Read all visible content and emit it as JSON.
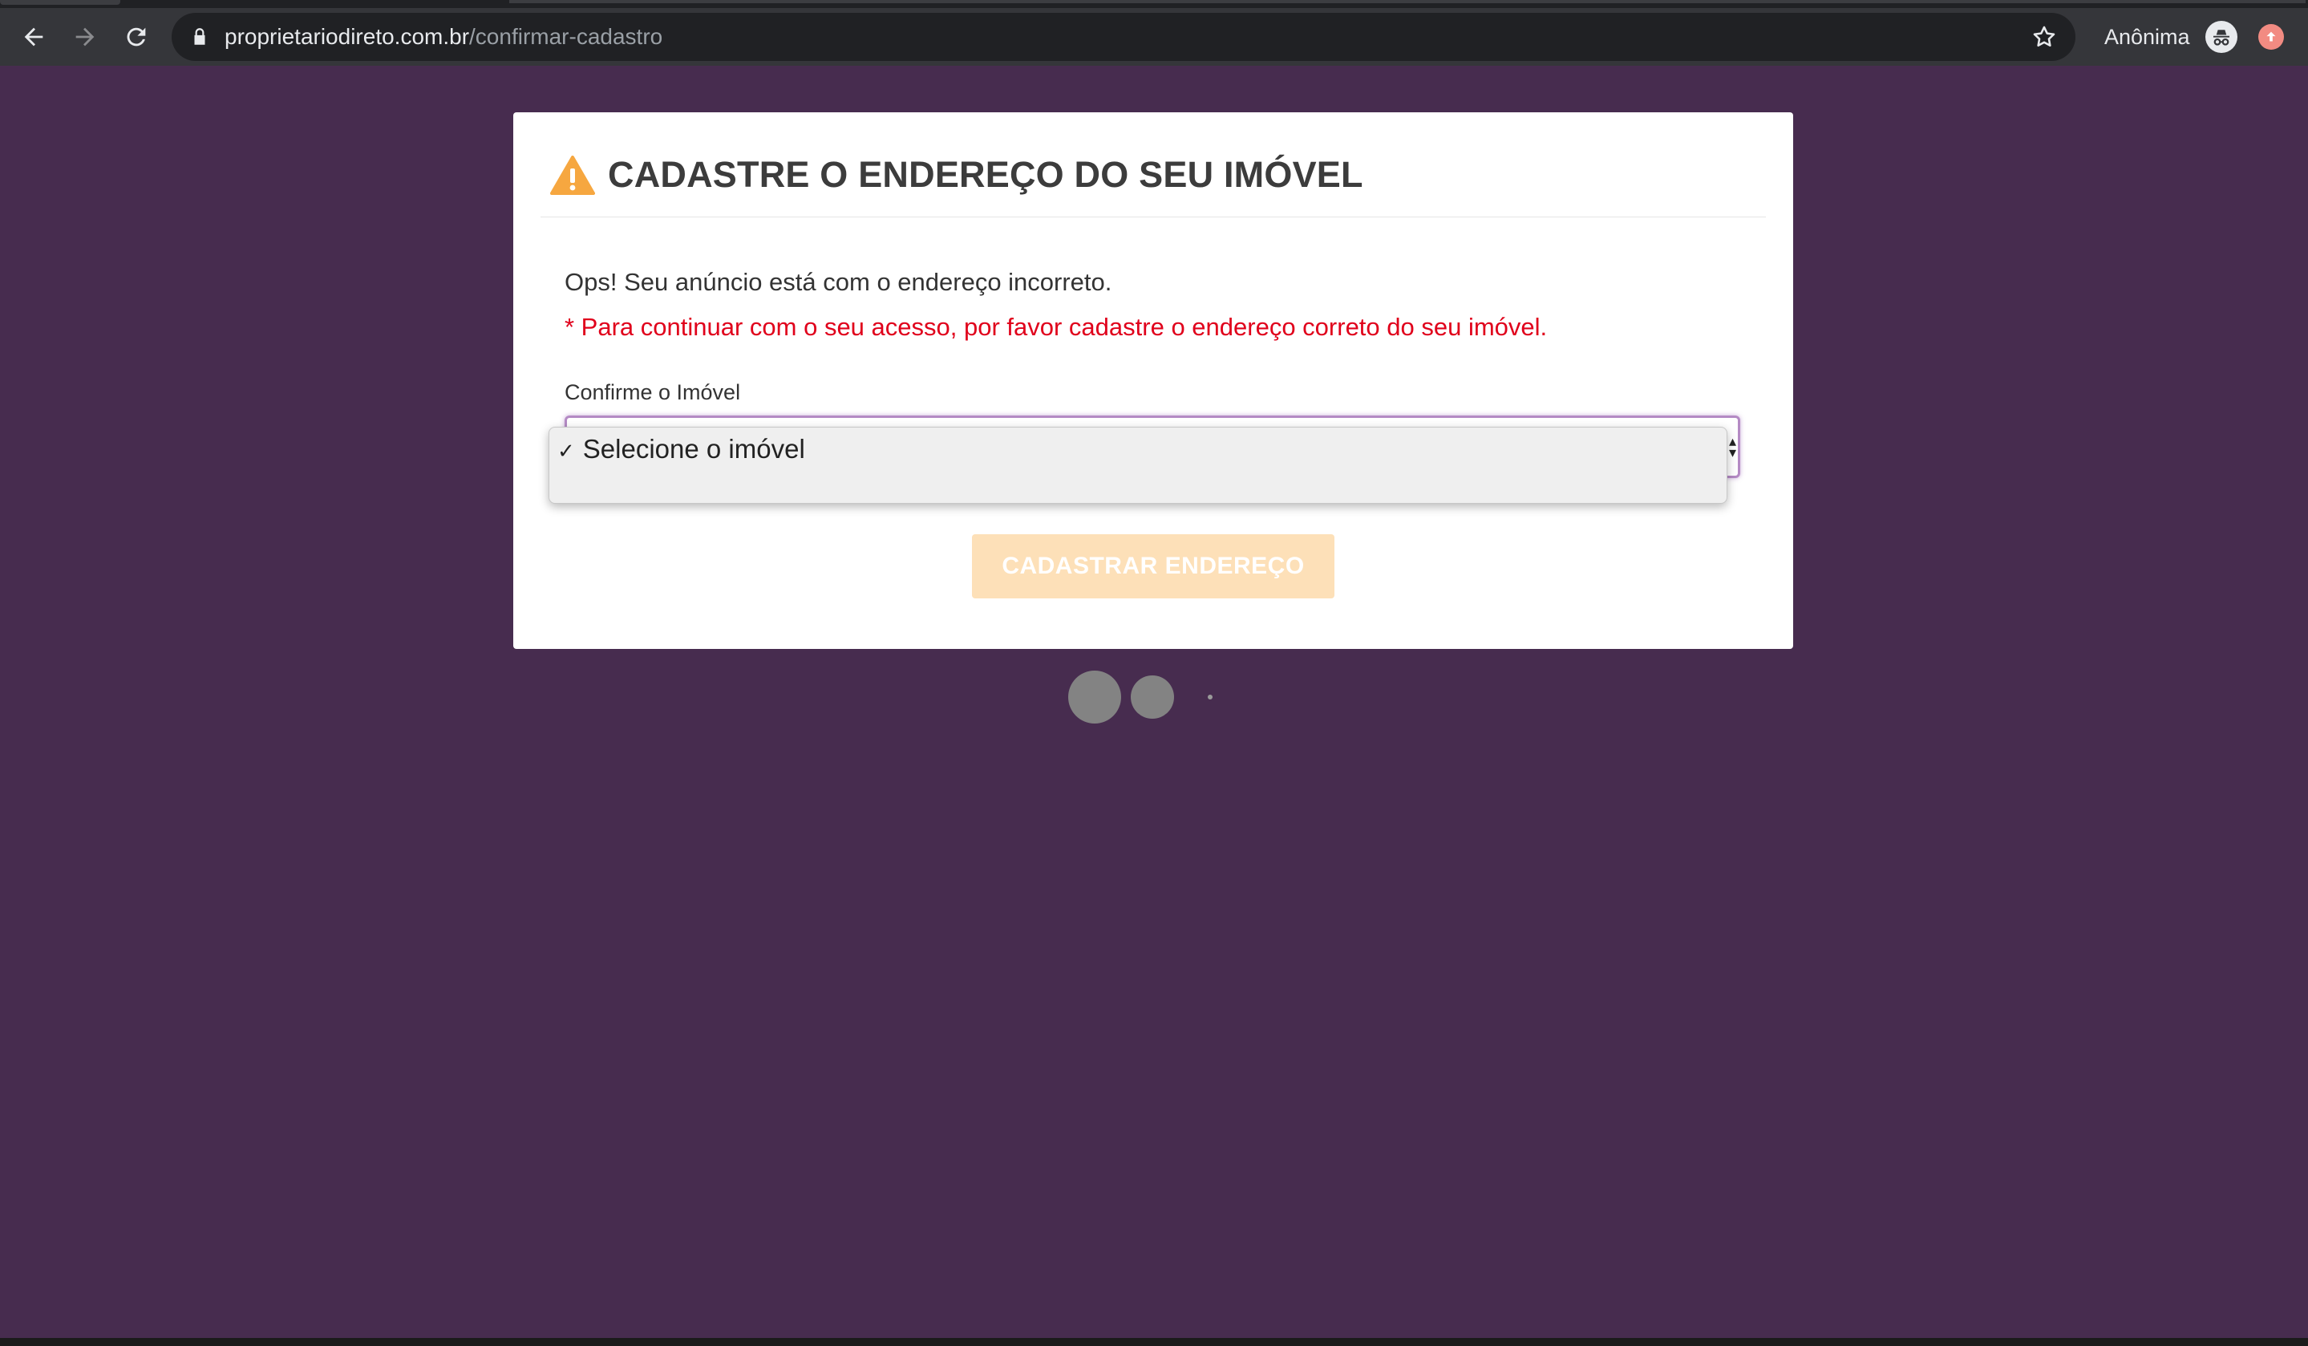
{
  "browser": {
    "url_domain": "proprietariodireto.com.br",
    "url_path": "/confirmar-cadastro",
    "profile_label": "Anônima",
    "icons": {
      "back": "arrow-left-icon",
      "forward": "arrow-right-icon",
      "reload": "reload-icon",
      "lock": "lock-icon",
      "bookmark": "star-icon",
      "incognito": "incognito-icon",
      "update": "update-arrow-icon"
    }
  },
  "card": {
    "title": "CADASTRE O ENDEREÇO DO SEU IMÓVEL",
    "title_icon": "warning-icon",
    "message": "Ops! Seu anúncio está com o endereço incorreto.",
    "alert": "* Para continuar com o seu acesso, por favor cadastre o endereço correto do seu imóvel.",
    "field_label": "Confirme o Imóvel",
    "select": {
      "options": [
        {
          "label": "Selecione o imóvel",
          "selected": true
        }
      ]
    },
    "submit_label": "CADASTRAR ENDEREÇO"
  },
  "colors": {
    "page_background": "#472c4f",
    "alert_text": "#e0001b",
    "warning_icon": "#f6a740",
    "submit_button": "#fde0b8"
  }
}
